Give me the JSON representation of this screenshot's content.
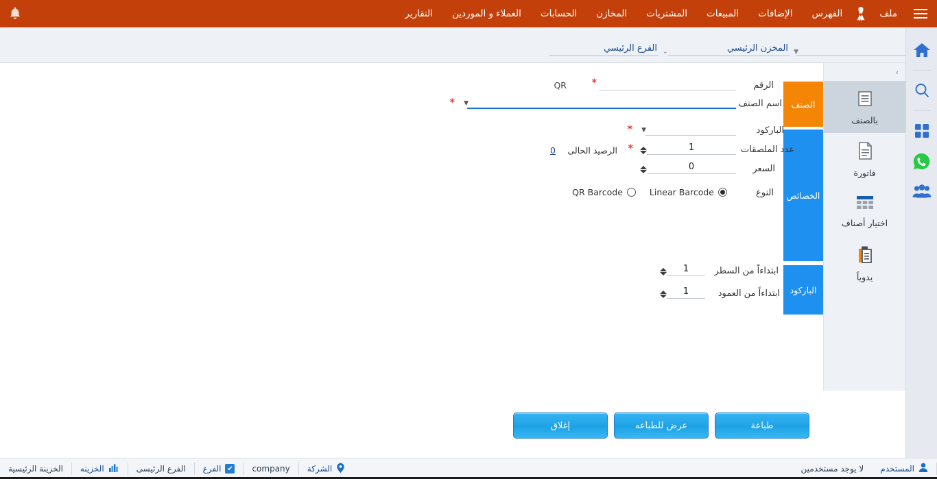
{
  "app": {
    "accent_orange": "#c4400a",
    "accent_blue": "#1e90f0",
    "tab_orange": "#f58505"
  },
  "topbar": {
    "bell_icon": "bell-icon",
    "hamburger_icon": "hamburger-icon",
    "ribbon_icon": "ribbon-icon",
    "items": [
      {
        "label": "ملف"
      },
      {
        "label": "الفهرس"
      },
      {
        "label": "الإضافات"
      },
      {
        "label": "المبيعات"
      },
      {
        "label": "المشتريات"
      },
      {
        "label": "المخازن"
      },
      {
        "label": "الحسابات"
      },
      {
        "label": "العملاء و الموردين"
      },
      {
        "label": "التقارير"
      }
    ]
  },
  "toolbar": {
    "branch": {
      "value": "الفرع الرئيسي",
      "caret_icon": "chevron-down-icon"
    },
    "store": {
      "value": "المخزن الرئيسي",
      "caret_icon": "caret-down-icon"
    },
    "extra": {
      "value": "",
      "check_icon": "check-icon",
      "caret_icon": "chevron-down-icon"
    }
  },
  "section_tabs": [
    {
      "label": "الصنف"
    },
    {
      "label": "الخصائص"
    },
    {
      "label": "الباركود"
    }
  ],
  "form": {
    "number": {
      "label": "الرقم",
      "value": "",
      "required": "*",
      "qr_label": "QR"
    },
    "item_name": {
      "label": "اسم الصنف",
      "value": "",
      "required": "*",
      "caret_icon": "caret-down-icon"
    },
    "barcode": {
      "label": "الباركود",
      "value": "",
      "required": "*",
      "caret_icon": "caret-down-icon"
    },
    "labels_count": {
      "label": "عدد الملصقات",
      "value": "1",
      "required": "*",
      "balance_label": "الرصيد الحالى",
      "balance_value": "0",
      "spinner_icon": "spinner-updown-icon"
    },
    "price": {
      "label": "السعر",
      "value": "0",
      "spinner_icon": "spinner-updown-icon"
    },
    "type": {
      "label": "النوع",
      "option_qr": "QR Barcode",
      "option_linear": "Linear Barcode",
      "selected": "Linear Barcode"
    },
    "start_row": {
      "label": "ابتداءاً من السطر",
      "value": "1",
      "spinner_icon": "spinner-updown-icon"
    },
    "start_col": {
      "label": "ابتداءاً من العمود",
      "value": "1",
      "spinner_icon": "spinner-updown-icon"
    }
  },
  "right_panel": {
    "collapse_icon": "chevron-right-icon",
    "modes": [
      {
        "label": "بالصنف",
        "icon": "lines-document-icon",
        "active": true
      },
      {
        "label": "فاتورة",
        "icon": "invoice-document-icon",
        "active": false
      },
      {
        "label": "اختيار أصناف",
        "icon": "grid-table-icon",
        "active": false
      },
      {
        "label": "يدوياً",
        "icon": "clipboard-icon",
        "active": false
      }
    ]
  },
  "rail": {
    "icons": [
      {
        "name": "home-icon"
      },
      {
        "name": "search-icon"
      },
      {
        "name": "apps-grid-icon"
      },
      {
        "name": "whatsapp-icon"
      },
      {
        "name": "users-group-icon"
      }
    ]
  },
  "actions": {
    "print": "طباعة",
    "print_preview": "عرض للطباعه",
    "close": "إغلاق"
  },
  "statusbar": {
    "user_icon": "user-icon",
    "user_label": "المستخدم",
    "user_value": "لا يوجد مستخدمين",
    "location_icon": "location-pin-icon",
    "company_label": "الشركة",
    "company_value": "company",
    "branch_check_icon": "check-icon",
    "branch_label": "الفرع",
    "branch_value": "الفرع الرئيسى",
    "treasury_icon": "chart-bars-icon",
    "treasury_label": "الخزينه",
    "treasury_value": "الخزينة الرئيسية"
  }
}
